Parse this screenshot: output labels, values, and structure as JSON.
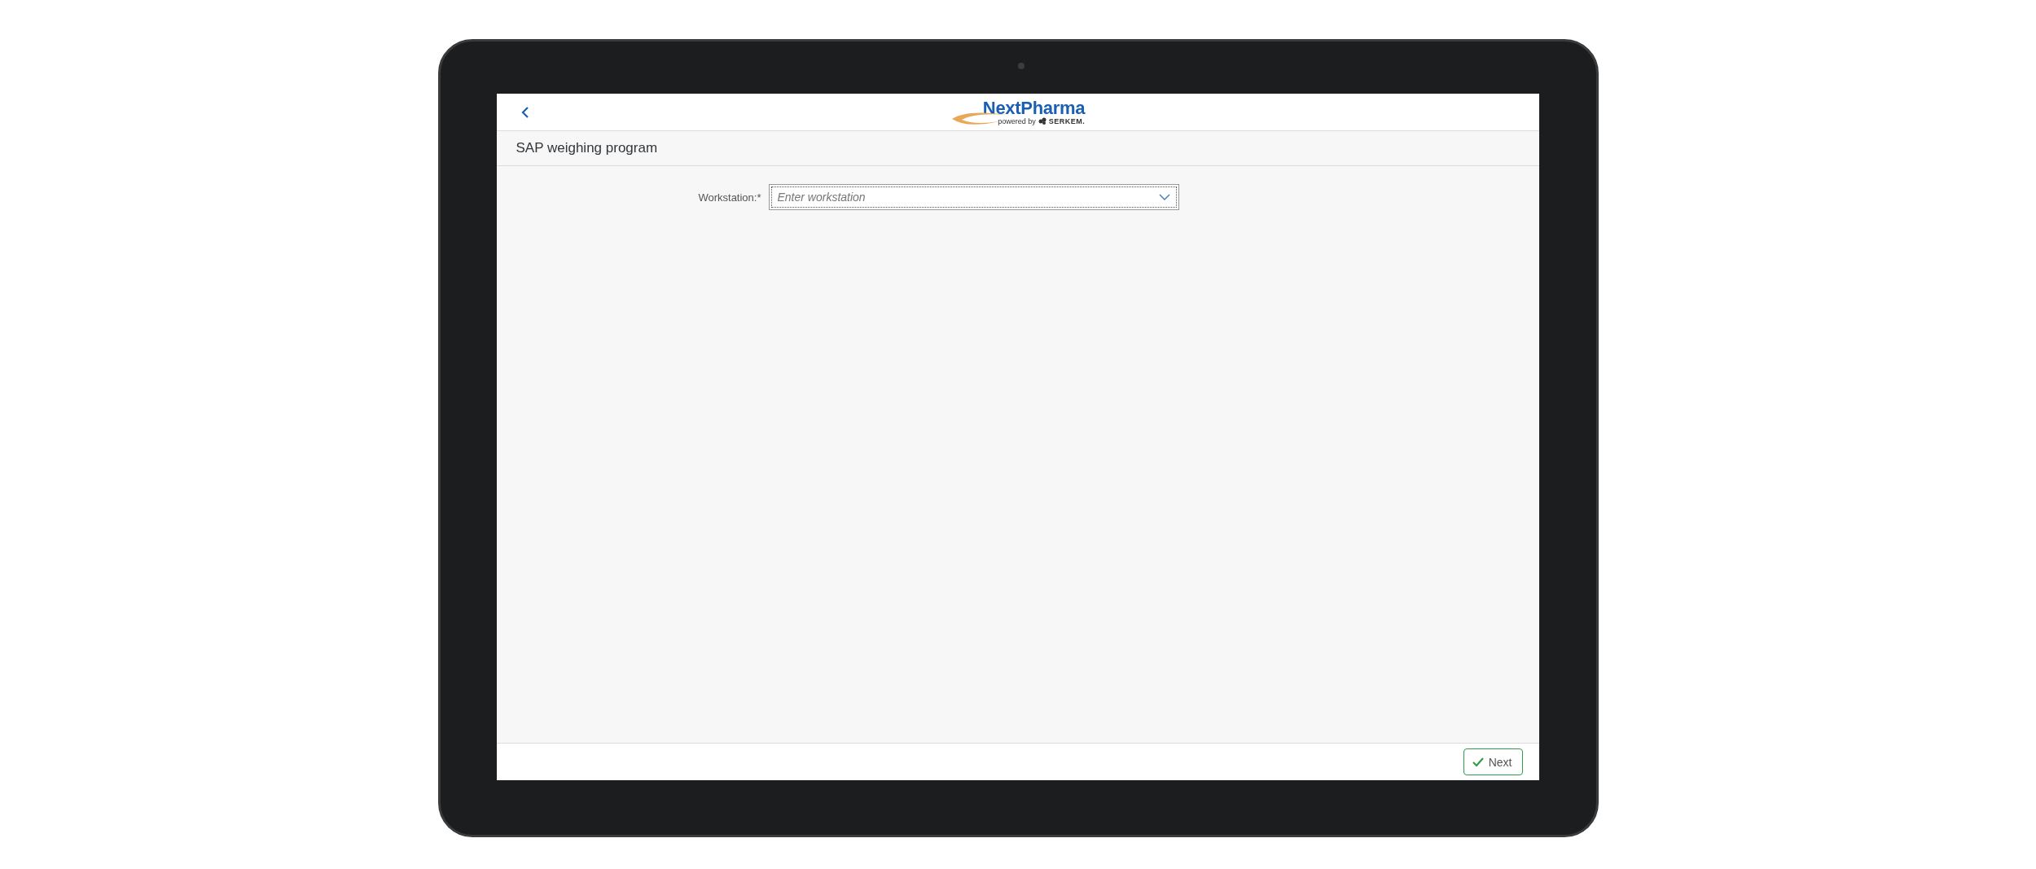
{
  "header": {
    "logo": {
      "brand": "NextPharma",
      "tagline": "powered by",
      "maker": "SERKEM."
    }
  },
  "page": {
    "title": "SAP weighing program"
  },
  "form": {
    "fields": [
      {
        "kind": "combobox",
        "label": "Workstation:*",
        "placeholder": "Enter workstation"
      }
    ]
  },
  "footer": {
    "buttons": [
      {
        "label": "Next"
      }
    ]
  }
}
